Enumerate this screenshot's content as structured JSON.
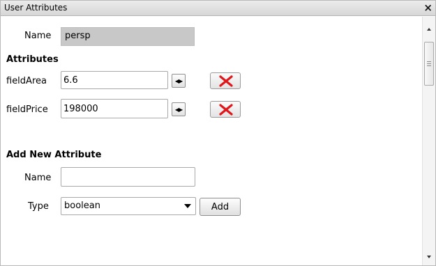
{
  "window": {
    "title": "User Attributes",
    "close_glyph": "×"
  },
  "object": {
    "name_label": "Name",
    "name_value": "persp"
  },
  "attributes": {
    "heading": "Attributes",
    "items": [
      {
        "label": "fieldArea",
        "value": "6.6"
      },
      {
        "label": "fieldPrice",
        "value": "198000"
      }
    ],
    "step_glyph": "◀▶"
  },
  "add_new": {
    "heading": "Add New Attribute",
    "name_label": "Name",
    "name_value": "",
    "type_label": "Type",
    "type_selected": "boolean",
    "add_label": "Add"
  },
  "colors": {
    "delete_x": "#e0161b"
  }
}
